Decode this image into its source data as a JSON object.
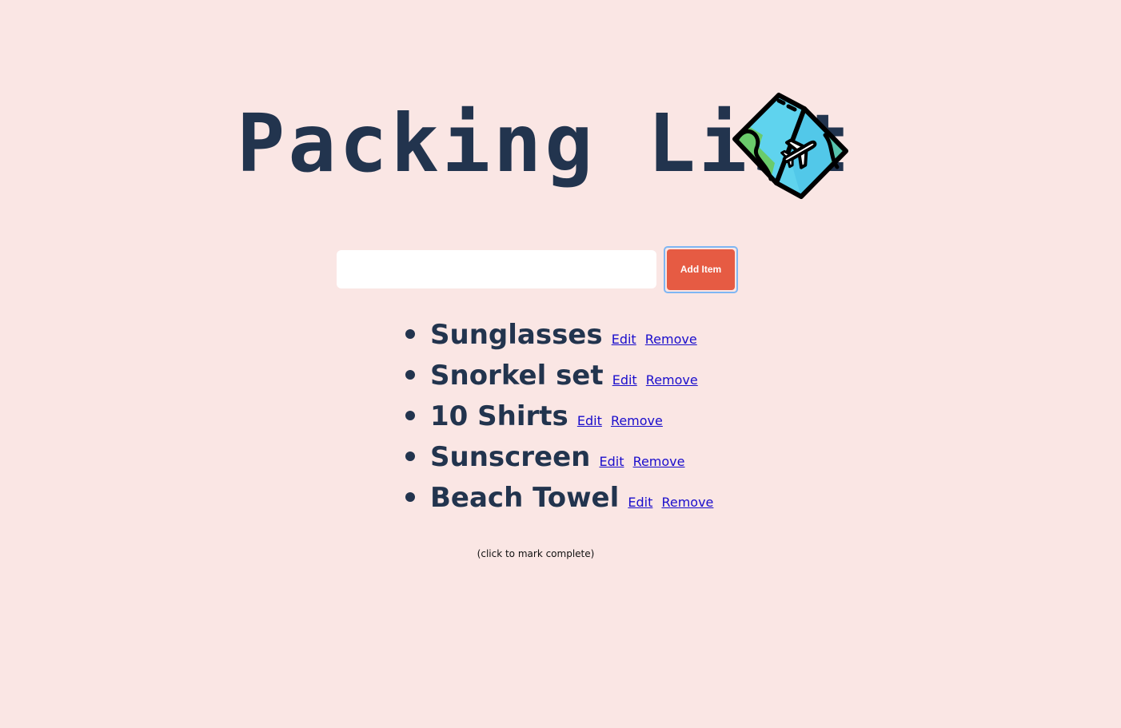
{
  "header": {
    "title": "Packing List",
    "icon": "travel-map-icon"
  },
  "form": {
    "input_value": "",
    "input_placeholder": "",
    "add_label": "Add Item"
  },
  "items": [
    {
      "name": "Sunglasses",
      "edit_label": "Edit",
      "remove_label": "Remove"
    },
    {
      "name": "Snorkel set",
      "edit_label": "Edit",
      "remove_label": "Remove"
    },
    {
      "name": "10 Shirts",
      "edit_label": "Edit",
      "remove_label": "Remove"
    },
    {
      "name": "Sunscreen",
      "edit_label": "Edit",
      "remove_label": "Remove"
    },
    {
      "name": "Beach Towel",
      "edit_label": "Edit",
      "remove_label": "Remove"
    }
  ],
  "hint": "(click to mark complete)",
  "colors": {
    "background": "#fae6e4",
    "text": "#22344e",
    "accent": "#e65b43",
    "focus_ring": "#7eb6f3",
    "link": "#1a0dcc",
    "map_blue": "#5fd3ee",
    "map_green": "#6acb6b"
  }
}
